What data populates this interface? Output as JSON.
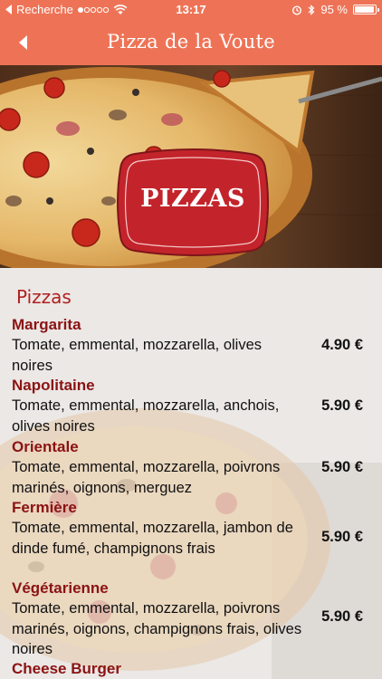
{
  "status_bar": {
    "carrier": "Recherche",
    "time": "13:17",
    "battery": "95 %",
    "battery_level": 0.95
  },
  "nav": {
    "title": "Pizza de la Voute"
  },
  "hero": {
    "badge_text": "PIZZAS"
  },
  "menu": {
    "section_title": "Pizzas",
    "items": [
      {
        "name": "Margarita",
        "desc": "Tomate, emmental, mozzarella, olives noires",
        "price": "4.90 €"
      },
      {
        "name": "Napolitaine",
        "desc": "Tomate, emmental, mozzarella, anchois, olives noires",
        "price": "5.90 €"
      },
      {
        "name": "Orientale",
        "desc": "Tomate, emmental, mozzarella, poivrons marinés, oignons, merguez",
        "price": "5.90 €"
      },
      {
        "name": "Fermière",
        "desc": "Tomate, emmental, mozzarella, jambon de dinde fumé, champignons frais",
        "price": "5.90 €"
      },
      {
        "name": "Végétarienne",
        "desc": "Tomate, emmental, mozzarella, poivrons marinés, oignons, champignons frais, olives noires",
        "price": "5.90 €"
      },
      {
        "name": "Cheese Burger",
        "desc": "",
        "price": ""
      }
    ]
  },
  "colors": {
    "accent": "#ee7356",
    "item_name": "#8b1313",
    "section_title": "#b0201e",
    "badge": "#c3242b"
  }
}
